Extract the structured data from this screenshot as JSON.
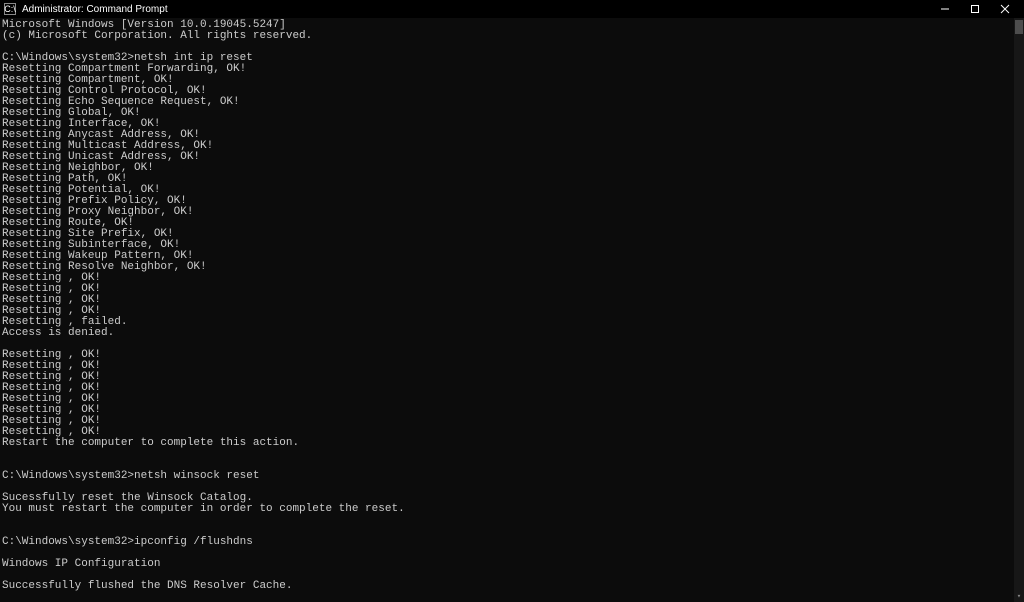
{
  "titlebar": {
    "icon_label": "C:\\",
    "title": "Administrator: Command Prompt"
  },
  "terminal": {
    "lines": [
      "Microsoft Windows [Version 10.0.19045.5247]",
      "(c) Microsoft Corporation. All rights reserved.",
      "",
      "C:\\Windows\\system32>netsh int ip reset",
      "Resetting Compartment Forwarding, OK!",
      "Resetting Compartment, OK!",
      "Resetting Control Protocol, OK!",
      "Resetting Echo Sequence Request, OK!",
      "Resetting Global, OK!",
      "Resetting Interface, OK!",
      "Resetting Anycast Address, OK!",
      "Resetting Multicast Address, OK!",
      "Resetting Unicast Address, OK!",
      "Resetting Neighbor, OK!",
      "Resetting Path, OK!",
      "Resetting Potential, OK!",
      "Resetting Prefix Policy, OK!",
      "Resetting Proxy Neighbor, OK!",
      "Resetting Route, OK!",
      "Resetting Site Prefix, OK!",
      "Resetting Subinterface, OK!",
      "Resetting Wakeup Pattern, OK!",
      "Resetting Resolve Neighbor, OK!",
      "Resetting , OK!",
      "Resetting , OK!",
      "Resetting , OK!",
      "Resetting , OK!",
      "Resetting , failed.",
      "Access is denied.",
      "",
      "Resetting , OK!",
      "Resetting , OK!",
      "Resetting , OK!",
      "Resetting , OK!",
      "Resetting , OK!",
      "Resetting , OK!",
      "Resetting , OK!",
      "Resetting , OK!",
      "Restart the computer to complete this action.",
      "",
      "",
      "C:\\Windows\\system32>netsh winsock reset",
      "",
      "Sucessfully reset the Winsock Catalog.",
      "You must restart the computer in order to complete the reset.",
      "",
      "",
      "C:\\Windows\\system32>ipconfig /flushdns",
      "",
      "Windows IP Configuration",
      "",
      "Successfully flushed the DNS Resolver Cache."
    ]
  }
}
